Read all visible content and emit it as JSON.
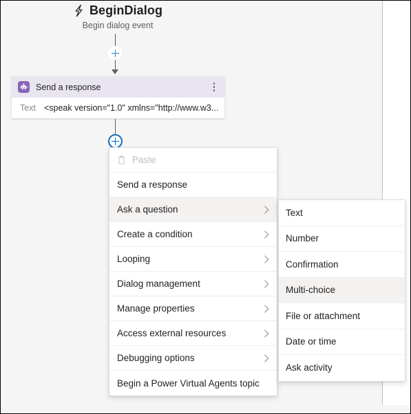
{
  "trigger": {
    "icon": "lightning-bolt-icon",
    "title": "BeginDialog",
    "subtitle": "Begin dialog event"
  },
  "connectors": {
    "add_button_top": "+",
    "add_button_active": "+"
  },
  "action_card": {
    "icon": "power-virtual-agents-bot-icon",
    "title": "Send a response",
    "menu_icon": "kebab-menu-icon",
    "field_label": "Text",
    "field_value": "<speak version=\"1.0\" xmlns=\"http://www.w3...."
  },
  "context_menu": {
    "items": [
      {
        "label": "Paste",
        "icon": "clipboard-icon",
        "disabled": true,
        "has_submenu": false,
        "selected": false
      },
      {
        "label": "Send a response",
        "disabled": false,
        "has_submenu": false,
        "selected": false
      },
      {
        "label": "Ask a question",
        "disabled": false,
        "has_submenu": true,
        "selected": true
      },
      {
        "label": "Create a condition",
        "disabled": false,
        "has_submenu": true,
        "selected": false
      },
      {
        "label": "Looping",
        "disabled": false,
        "has_submenu": true,
        "selected": false
      },
      {
        "label": "Dialog management",
        "disabled": false,
        "has_submenu": true,
        "selected": false
      },
      {
        "label": "Manage properties",
        "disabled": false,
        "has_submenu": true,
        "selected": false
      },
      {
        "label": "Access external resources",
        "disabled": false,
        "has_submenu": true,
        "selected": false
      },
      {
        "label": "Debugging options",
        "disabled": false,
        "has_submenu": true,
        "selected": false
      },
      {
        "label": "Begin a Power Virtual Agents topic",
        "disabled": false,
        "has_submenu": false,
        "selected": false
      }
    ]
  },
  "submenu": {
    "parent": "Ask a question",
    "items": [
      {
        "label": "Text",
        "selected": false
      },
      {
        "label": "Number",
        "selected": false
      },
      {
        "label": "Confirmation",
        "selected": false
      },
      {
        "label": "Multi-choice",
        "selected": true
      },
      {
        "label": "File or attachment",
        "selected": false
      },
      {
        "label": "Date or time",
        "selected": false
      },
      {
        "label": "Ask activity",
        "selected": false
      }
    ]
  },
  "colors": {
    "canvas_bg": "#f5f5f5",
    "card_header_bg": "#e8e5f0",
    "card_icon_bg": "#8764b8",
    "accent_blue": "#0f6cbd",
    "plus_blue": "#2b88d8",
    "highlight_bg": "#f3f2f1",
    "text_primary": "#201f1e",
    "text_secondary": "#605e5c",
    "text_disabled": "#bdbdbd"
  }
}
